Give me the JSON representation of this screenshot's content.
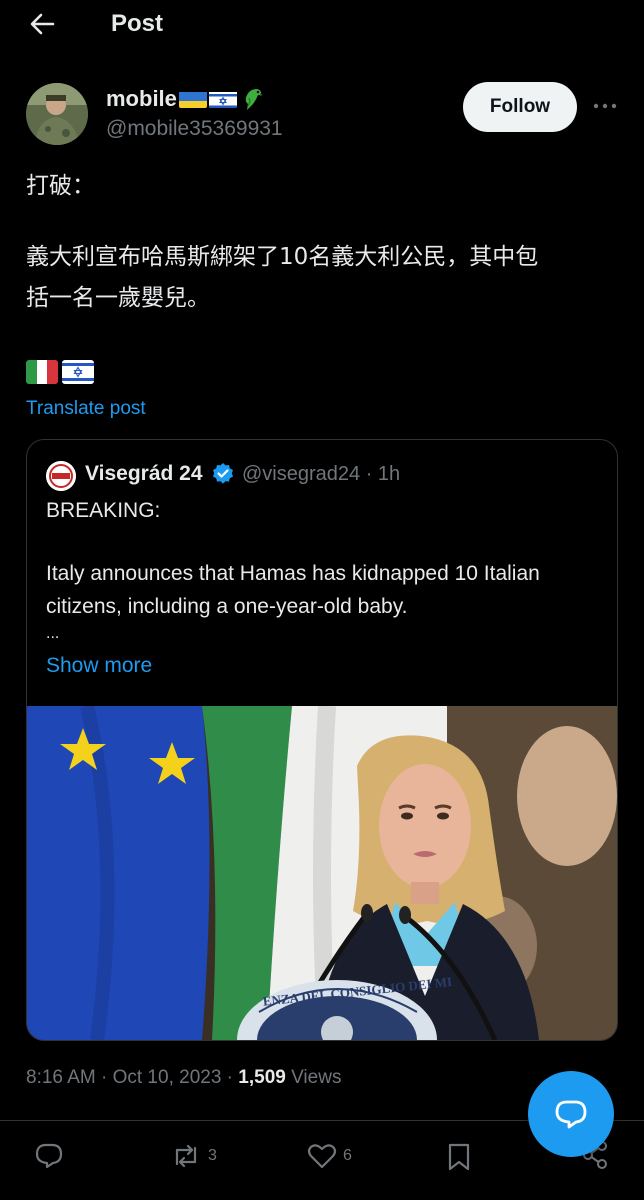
{
  "header": {
    "title": "Post"
  },
  "author": {
    "name": "mobile",
    "handle": "@mobile35369931",
    "badges": [
      "ukraine-flag",
      "israel-flag",
      "parrot"
    ]
  },
  "follow_label": "Follow",
  "post": {
    "lines": [
      "打破：",
      "義大利宣布哈馬斯綁架了10名義大利公民，其中包",
      "括一名一歲嬰兒。"
    ],
    "flags": [
      "italy-flag",
      "israel-flag"
    ],
    "translate_label": "Translate post"
  },
  "quote": {
    "name": "Visegrád 24",
    "handle_time": "@visegrad24 · 1h",
    "lines": [
      "BREAKING:",
      "Italy announces that Hamas has kidnapped 10 Italian",
      "citizens, including a one-year-old baby.",
      "..."
    ],
    "show_more": "Show more",
    "image_banner_text": "ENZA DEL CONSIGLIO DEI MI"
  },
  "meta": {
    "time": "8:16 AM · Oct 10, 2023 · ",
    "views_count": "1,509",
    "views_label": " Views"
  },
  "actions": {
    "reply_count": "",
    "repost_count": "3",
    "like_count": "6"
  },
  "colors": {
    "accent": "#1d9bf0",
    "background": "#000000",
    "muted": "#71767b"
  }
}
